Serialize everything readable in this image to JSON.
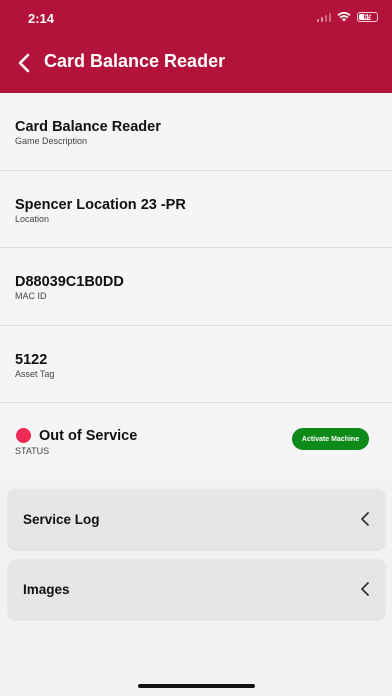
{
  "status_bar": {
    "time": "2:14",
    "battery_level": "65"
  },
  "header": {
    "title": "Card Balance Reader",
    "back_icon": "chevron-left-icon",
    "background": "#b3123a"
  },
  "details": [
    {
      "value": "Card Balance Reader",
      "label": "Game Description"
    },
    {
      "value": "Spencer Location 23 -PR",
      "label": "Location"
    },
    {
      "value": "D88039C1B0DD",
      "label": "MAC ID"
    },
    {
      "value": "5122",
      "label": "Asset Tag"
    }
  ],
  "status": {
    "value": "Out of Service",
    "label": "STATUS",
    "dot_color": "#ee2a55",
    "action_label": "Activate Machine",
    "action_color": "#0d8a1a"
  },
  "sections": [
    {
      "label": "Service Log",
      "icon": "chevron-left-icon"
    },
    {
      "label": "Images",
      "icon": "chevron-left-icon"
    }
  ]
}
